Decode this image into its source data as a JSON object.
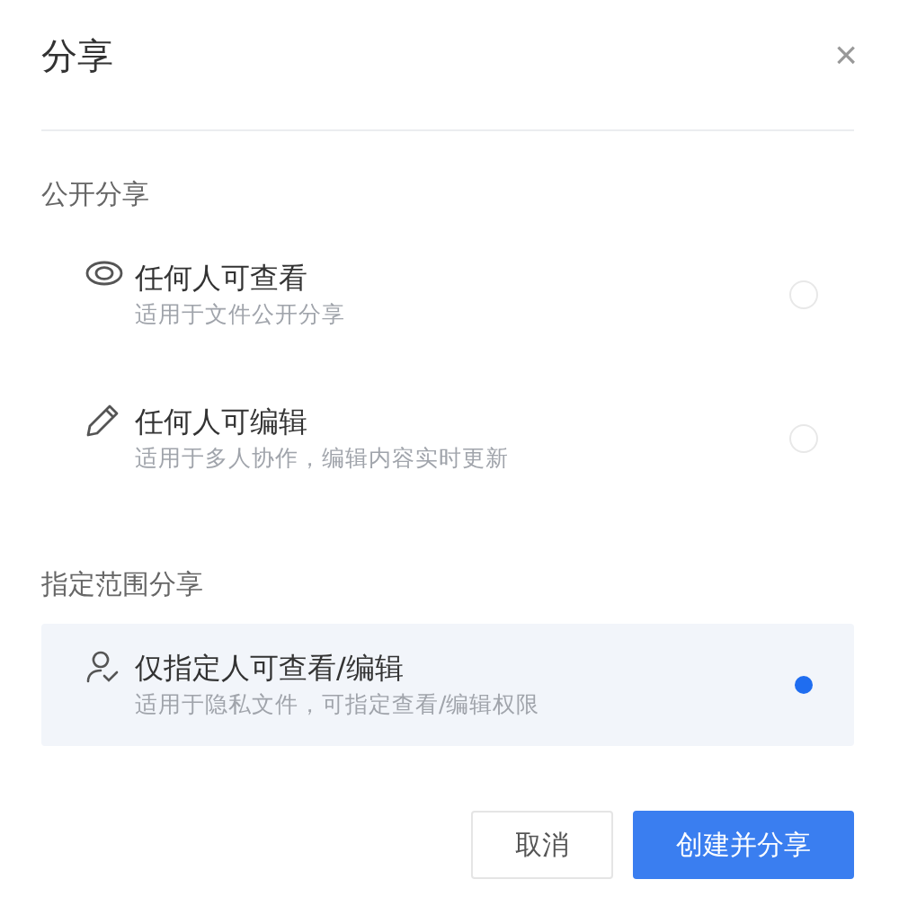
{
  "dialog": {
    "title": "分享",
    "close": "×"
  },
  "sections": [
    {
      "heading": "公开分享",
      "options": [
        {
          "kind": "eye",
          "title": "任何人可查看",
          "description": "适用于文件公开分享",
          "selected": false
        },
        {
          "kind": "pencil",
          "title": "任何人可编辑",
          "description": "适用于多人协作，编辑内容实时更新",
          "selected": false
        }
      ]
    },
    {
      "heading": "指定范围分享",
      "options": [
        {
          "kind": "person",
          "title": "仅指定人可查看/编辑",
          "description": "适用于隐私文件，可指定查看/编辑权限",
          "selected": true
        }
      ]
    }
  ],
  "buttons": [
    {
      "kind": "secondary",
      "label": "取消"
    },
    {
      "kind": "primary",
      "label": "创建并分享"
    }
  ]
}
